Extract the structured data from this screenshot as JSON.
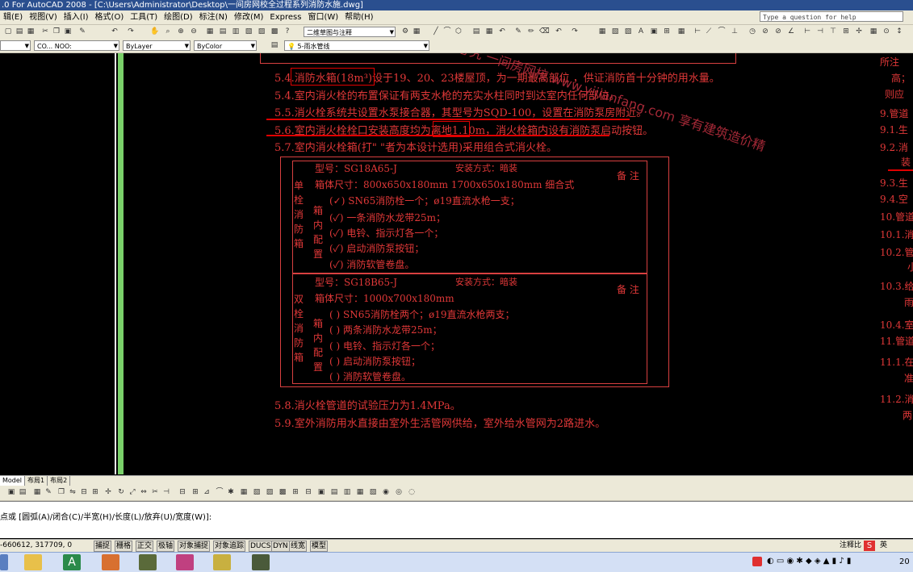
{
  "window": {
    "title": ".0 For AutoCAD 2008 - [C:\\Users\\Administrator\\Desktop\\一间房网校全过程系列消防水施.dwg]",
    "help_placeholder": "Type a question for help"
  },
  "menu": [
    "辑(E)",
    "视图(V)",
    "插入(I)",
    "格式(O)",
    "工具(T)",
    "绘图(D)",
    "标注(N)",
    "修改(M)",
    "Express",
    "窗口(W)",
    "帮助(H)"
  ],
  "toolbar": {
    "workspace": "二维草图与注释",
    "layer": "5-雨水管线",
    "linetype1": "CO... NOO:",
    "linetype2": "ByLayer",
    "color": "ByColor"
  },
  "drawing": {
    "lines": [
      "5.4.消防水箱(18m³)设于19、20、23楼屋顶，为一期最高部位        ，供证消防首十分钟的用水量。",
      "5.4.室内消火栓的布置保证有两支水枪的充实水柱同时到达室内任何部位。",
      "5.5.消火栓系统共设置水泵接合器，其型号为SQD-100，设置在消防泵房附近。",
      "5.6.室内消火栓栓口安装高度均为离地1.10m，消火栓箱内设有消防泵启动按钮。",
      "5.7.室内消火栓箱(打\"   \"者为本设计选用)采用组合式消火栓。"
    ],
    "table": {
      "single": {
        "label": "单栓消防箱",
        "model": "型号：SG18A65-J",
        "install": "安装方式：暗装",
        "size": "箱体尺寸：800x650x180mm     1700x650x180mm 细合式",
        "inner_label": "箱内配置",
        "items": [
          "(✓) SN65消防栓一个；ø19直流水枪一支；",
          "(✓) 一条消防水龙带25m；",
          "(✓) 电铃、指示灯各一个；",
          "(✓) 启动消防泵按钮；",
          "(✓) 消防软管卷盘。"
        ],
        "note": "备 注"
      },
      "double": {
        "label": "双栓消防箱",
        "model": "型号：SG18B65-J",
        "install": "安装方式：暗装",
        "size": "箱体尺寸：1000x700x180mm",
        "inner_label": "箱内配置",
        "items": [
          "(  ) SN65消防栓两个；ø19直流水枪两支；",
          "(  ) 两条消防水龙带25m；",
          "(  ) 电铃、指示灯各一个；",
          "(  ) 启动消防泵按钮；",
          "(  ) 消防软管卷盘。"
        ],
        "note": "备 注"
      }
    },
    "after": [
      "5.8.消火栓管道的试验压力为1.4MPa。",
      "5.9.室外消防用水直接由室外生活管网供给，室外给水管网为2路进水。"
    ],
    "right_col": [
      "所注",
      "高；",
      "则应",
      "9.管道",
      "9.1.生",
      "9.2.消",
      "装",
      "9.3.生",
      "9.4.空",
      "10.管道",
      "10.1.消",
      "10.2.管",
      "小",
      "10.3.给",
      "雨",
      "10.4.室",
      "11.管道",
      "11.1.在",
      "准",
      "11.2.消",
      "两"
    ],
    "watermark": "权所有，侵权必究 一间房网校 www.yijianfang.com 享有建筑造价精"
  },
  "tabs": [
    "Model",
    "布局1",
    "布局2"
  ],
  "command_line": "点或 [圆弧(A)/闭合(C)/半宽(H)/长度(L)/放弃(U)/宽度(W)]:",
  "status": {
    "coords": "-660612, 317709, 0",
    "buttons": [
      "捕捉",
      "栅格",
      "正交",
      "极轴",
      "对象捕捉",
      "对象追踪",
      "DUCS",
      "DYN",
      "线宽",
      "模型"
    ],
    "right": "注释比"
  },
  "tray": {
    "lang": "英",
    "time": "20"
  }
}
